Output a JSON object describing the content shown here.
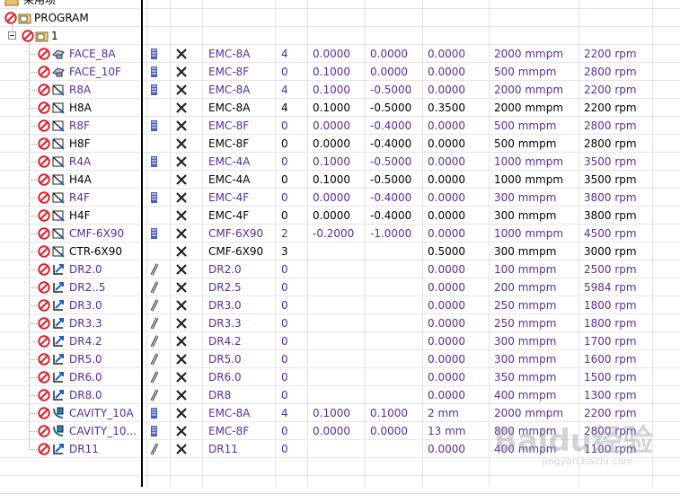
{
  "header": {
    "label": "采用项"
  },
  "tree": {
    "root_label": "PROGRAM",
    "group_label": "1"
  },
  "rows": [
    {
      "name": "FACE_8A",
      "icon": "face-mill",
      "style": "purple",
      "c1": true,
      "tool": "EMC-8A",
      "n": "4",
      "a": "0.0000",
      "b": "0.0000",
      "c": "0.0000",
      "speed": "2000 mmpm",
      "rpm": "2200 rpm"
    },
    {
      "name": "FACE_10F",
      "icon": "face-mill",
      "style": "purple",
      "c1": true,
      "tool": "EMC-8F",
      "n": "0",
      "a": "0.1000",
      "b": "0.0000",
      "c": "0.0000",
      "speed": "500 mmpm",
      "rpm": "2800 rpm"
    },
    {
      "name": "R8A",
      "icon": "profile",
      "style": "purple",
      "c1": true,
      "tool": "EMC-8A",
      "n": "4",
      "a": "0.1000",
      "b": "-0.5000",
      "c": "0.0000",
      "speed": "2000 mmpm",
      "rpm": "2200 rpm"
    },
    {
      "name": "H8A",
      "icon": "profile",
      "style": "black",
      "c1": false,
      "tool": "EMC-8A",
      "n": "4",
      "a": "0.1000",
      "b": "-0.5000",
      "c": "0.3500",
      "speed": "2000 mmpm",
      "rpm": "2200 rpm"
    },
    {
      "name": "R8F",
      "icon": "profile",
      "style": "purple",
      "c1": true,
      "tool": "EMC-8F",
      "n": "0",
      "a": "0.0000",
      "b": "-0.4000",
      "c": "0.0000",
      "speed": "500 mmpm",
      "rpm": "2800 rpm"
    },
    {
      "name": "H8F",
      "icon": "profile",
      "style": "black",
      "c1": false,
      "tool": "EMC-8F",
      "n": "0",
      "a": "0.0000",
      "b": "-0.4000",
      "c": "0.0000",
      "speed": "500 mmpm",
      "rpm": "2800 rpm"
    },
    {
      "name": "R4A",
      "icon": "profile",
      "style": "purple",
      "c1": true,
      "tool": "EMC-4A",
      "n": "0",
      "a": "0.1000",
      "b": "-0.5000",
      "c": "0.0000",
      "speed": "1000 mmpm",
      "rpm": "3500 rpm"
    },
    {
      "name": "H4A",
      "icon": "profile",
      "style": "black",
      "c1": false,
      "tool": "EMC-4A",
      "n": "0",
      "a": "0.1000",
      "b": "-0.5000",
      "c": "0.0000",
      "speed": "1000 mmpm",
      "rpm": "3500 rpm"
    },
    {
      "name": "R4F",
      "icon": "profile",
      "style": "purple",
      "c1": true,
      "tool": "EMC-4F",
      "n": "0",
      "a": "0.0000",
      "b": "-0.4000",
      "c": "0.0000",
      "speed": "300 mmpm",
      "rpm": "3800 rpm"
    },
    {
      "name": "H4F",
      "icon": "profile",
      "style": "black",
      "c1": false,
      "tool": "EMC-4F",
      "n": "0",
      "a": "0.0000",
      "b": "-0.4000",
      "c": "0.0000",
      "speed": "300 mmpm",
      "rpm": "3800 rpm"
    },
    {
      "name": "CMF-6X90",
      "icon": "profile",
      "style": "purple",
      "c1": true,
      "tool": "CMF-6X90",
      "n": "2",
      "a": "-0.2000",
      "b": "-1.0000",
      "c": "0.0000",
      "speed": "1000 mmpm",
      "rpm": "4500 rpm"
    },
    {
      "name": "CTR-6X90",
      "icon": "profile",
      "style": "black",
      "c1": false,
      "tool": "CMF-6X90",
      "n": "3",
      "a": "",
      "b": "",
      "c": "0.5000",
      "speed": "300 mmpm",
      "rpm": "3000 rpm"
    },
    {
      "name": "DR2.0",
      "icon": "drill",
      "style": "purple",
      "c1": true,
      "c1drill": true,
      "tool": "DR2.0",
      "n": "0",
      "a": "",
      "b": "",
      "c": "0.0000",
      "speed": "100 mmpm",
      "rpm": "2500 rpm"
    },
    {
      "name": "DR2..5",
      "icon": "drill",
      "style": "purple",
      "c1": true,
      "c1drill": true,
      "tool": "DR2.5",
      "n": "0",
      "a": "",
      "b": "",
      "c": "0.0000",
      "speed": "200 mmpm",
      "rpm": "5984 rpm"
    },
    {
      "name": "DR3.0",
      "icon": "drill",
      "style": "purple",
      "c1": true,
      "c1drill": true,
      "tool": "DR3.0",
      "n": "0",
      "a": "",
      "b": "",
      "c": "0.0000",
      "speed": "250 mmpm",
      "rpm": "1800 rpm"
    },
    {
      "name": "DR3.3",
      "icon": "drill",
      "style": "purple",
      "c1": true,
      "c1drill": true,
      "tool": "DR3.3",
      "n": "0",
      "a": "",
      "b": "",
      "c": "0.0000",
      "speed": "250 mmpm",
      "rpm": "1800 rpm"
    },
    {
      "name": "DR4.2",
      "icon": "drill",
      "style": "purple",
      "c1": true,
      "c1drill": true,
      "tool": "DR4.2",
      "n": "0",
      "a": "",
      "b": "",
      "c": "0.0000",
      "speed": "300 mmpm",
      "rpm": "1700 rpm"
    },
    {
      "name": "DR5.0",
      "icon": "drill",
      "style": "purple",
      "c1": true,
      "c1drill": true,
      "tool": "DR5.0",
      "n": "0",
      "a": "",
      "b": "",
      "c": "0.0000",
      "speed": "300 mmpm",
      "rpm": "1600 rpm"
    },
    {
      "name": "DR6.0",
      "icon": "drill",
      "style": "purple",
      "c1": true,
      "c1drill": true,
      "tool": "DR6.0",
      "n": "0",
      "a": "",
      "b": "",
      "c": "0.0000",
      "speed": "350 mmpm",
      "rpm": "1500 rpm"
    },
    {
      "name": "DR8.0",
      "icon": "drill",
      "style": "purple",
      "c1": true,
      "c1drill": true,
      "tool": "DR8",
      "n": "0",
      "a": "",
      "b": "",
      "c": "0.0000",
      "speed": "400 mmpm",
      "rpm": "1300 rpm"
    },
    {
      "name": "CAVITY_10A",
      "icon": "cavity",
      "style": "purple",
      "c1": true,
      "tool": "EMC-8A",
      "n": "4",
      "a": "0.1000",
      "b": "0.1000",
      "c": "2 mm",
      "speed": "2000 mmpm",
      "rpm": "2200 rpm"
    },
    {
      "name": "CAVITY_10...",
      "icon": "cavity",
      "style": "purple",
      "c1": true,
      "tool": "EMC-8F",
      "n": "0",
      "a": "0.0000",
      "b": "0.0000",
      "c": "13 mm",
      "speed": "800 mmpm",
      "rpm": "2800 rpm"
    },
    {
      "name": "DR11",
      "icon": "drill",
      "style": "purple",
      "c1": true,
      "c1drill": true,
      "tool": "DR11",
      "n": "0",
      "a": "",
      "b": "",
      "c": "0.0000",
      "speed": "400 mmpm",
      "rpm": "1100 rpm"
    }
  ],
  "watermark": {
    "logo": "Baidu经验",
    "url": "jingyan.baidu.com"
  },
  "colors": {
    "purple": "#5a2d9c",
    "no_sign": "#d9232e",
    "grid": "#e4e4ea"
  }
}
